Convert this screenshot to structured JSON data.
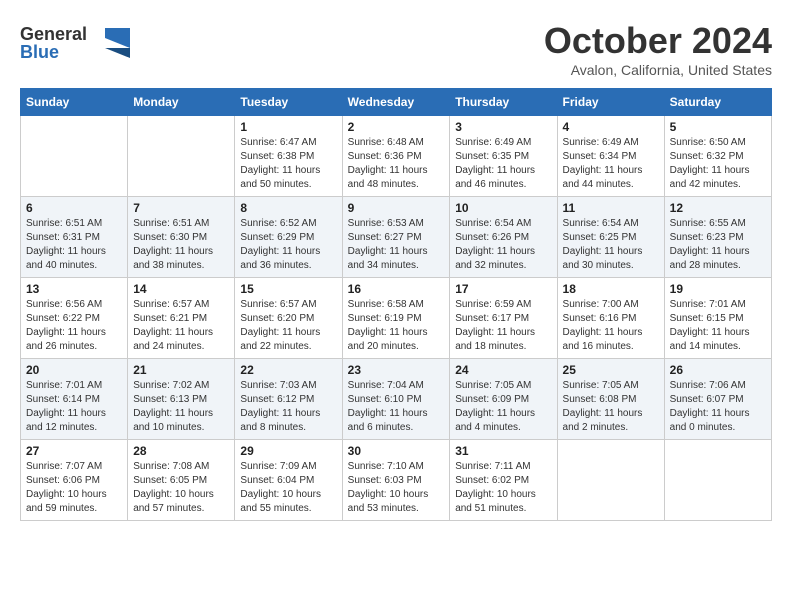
{
  "header": {
    "logo_line1": "General",
    "logo_line2": "Blue",
    "month_title": "October 2024",
    "location": "Avalon, California, United States"
  },
  "weekdays": [
    "Sunday",
    "Monday",
    "Tuesday",
    "Wednesday",
    "Thursday",
    "Friday",
    "Saturday"
  ],
  "weeks": [
    [
      {
        "day": "",
        "info": ""
      },
      {
        "day": "",
        "info": ""
      },
      {
        "day": "1",
        "info": "Sunrise: 6:47 AM\nSunset: 6:38 PM\nDaylight: 11 hours and 50 minutes."
      },
      {
        "day": "2",
        "info": "Sunrise: 6:48 AM\nSunset: 6:36 PM\nDaylight: 11 hours and 48 minutes."
      },
      {
        "day": "3",
        "info": "Sunrise: 6:49 AM\nSunset: 6:35 PM\nDaylight: 11 hours and 46 minutes."
      },
      {
        "day": "4",
        "info": "Sunrise: 6:49 AM\nSunset: 6:34 PM\nDaylight: 11 hours and 44 minutes."
      },
      {
        "day": "5",
        "info": "Sunrise: 6:50 AM\nSunset: 6:32 PM\nDaylight: 11 hours and 42 minutes."
      }
    ],
    [
      {
        "day": "6",
        "info": "Sunrise: 6:51 AM\nSunset: 6:31 PM\nDaylight: 11 hours and 40 minutes."
      },
      {
        "day": "7",
        "info": "Sunrise: 6:51 AM\nSunset: 6:30 PM\nDaylight: 11 hours and 38 minutes."
      },
      {
        "day": "8",
        "info": "Sunrise: 6:52 AM\nSunset: 6:29 PM\nDaylight: 11 hours and 36 minutes."
      },
      {
        "day": "9",
        "info": "Sunrise: 6:53 AM\nSunset: 6:27 PM\nDaylight: 11 hours and 34 minutes."
      },
      {
        "day": "10",
        "info": "Sunrise: 6:54 AM\nSunset: 6:26 PM\nDaylight: 11 hours and 32 minutes."
      },
      {
        "day": "11",
        "info": "Sunrise: 6:54 AM\nSunset: 6:25 PM\nDaylight: 11 hours and 30 minutes."
      },
      {
        "day": "12",
        "info": "Sunrise: 6:55 AM\nSunset: 6:23 PM\nDaylight: 11 hours and 28 minutes."
      }
    ],
    [
      {
        "day": "13",
        "info": "Sunrise: 6:56 AM\nSunset: 6:22 PM\nDaylight: 11 hours and 26 minutes."
      },
      {
        "day": "14",
        "info": "Sunrise: 6:57 AM\nSunset: 6:21 PM\nDaylight: 11 hours and 24 minutes."
      },
      {
        "day": "15",
        "info": "Sunrise: 6:57 AM\nSunset: 6:20 PM\nDaylight: 11 hours and 22 minutes."
      },
      {
        "day": "16",
        "info": "Sunrise: 6:58 AM\nSunset: 6:19 PM\nDaylight: 11 hours and 20 minutes."
      },
      {
        "day": "17",
        "info": "Sunrise: 6:59 AM\nSunset: 6:17 PM\nDaylight: 11 hours and 18 minutes."
      },
      {
        "day": "18",
        "info": "Sunrise: 7:00 AM\nSunset: 6:16 PM\nDaylight: 11 hours and 16 minutes."
      },
      {
        "day": "19",
        "info": "Sunrise: 7:01 AM\nSunset: 6:15 PM\nDaylight: 11 hours and 14 minutes."
      }
    ],
    [
      {
        "day": "20",
        "info": "Sunrise: 7:01 AM\nSunset: 6:14 PM\nDaylight: 11 hours and 12 minutes."
      },
      {
        "day": "21",
        "info": "Sunrise: 7:02 AM\nSunset: 6:13 PM\nDaylight: 11 hours and 10 minutes."
      },
      {
        "day": "22",
        "info": "Sunrise: 7:03 AM\nSunset: 6:12 PM\nDaylight: 11 hours and 8 minutes."
      },
      {
        "day": "23",
        "info": "Sunrise: 7:04 AM\nSunset: 6:10 PM\nDaylight: 11 hours and 6 minutes."
      },
      {
        "day": "24",
        "info": "Sunrise: 7:05 AM\nSunset: 6:09 PM\nDaylight: 11 hours and 4 minutes."
      },
      {
        "day": "25",
        "info": "Sunrise: 7:05 AM\nSunset: 6:08 PM\nDaylight: 11 hours and 2 minutes."
      },
      {
        "day": "26",
        "info": "Sunrise: 7:06 AM\nSunset: 6:07 PM\nDaylight: 11 hours and 0 minutes."
      }
    ],
    [
      {
        "day": "27",
        "info": "Sunrise: 7:07 AM\nSunset: 6:06 PM\nDaylight: 10 hours and 59 minutes."
      },
      {
        "day": "28",
        "info": "Sunrise: 7:08 AM\nSunset: 6:05 PM\nDaylight: 10 hours and 57 minutes."
      },
      {
        "day": "29",
        "info": "Sunrise: 7:09 AM\nSunset: 6:04 PM\nDaylight: 10 hours and 55 minutes."
      },
      {
        "day": "30",
        "info": "Sunrise: 7:10 AM\nSunset: 6:03 PM\nDaylight: 10 hours and 53 minutes."
      },
      {
        "day": "31",
        "info": "Sunrise: 7:11 AM\nSunset: 6:02 PM\nDaylight: 10 hours and 51 minutes."
      },
      {
        "day": "",
        "info": ""
      },
      {
        "day": "",
        "info": ""
      }
    ]
  ]
}
